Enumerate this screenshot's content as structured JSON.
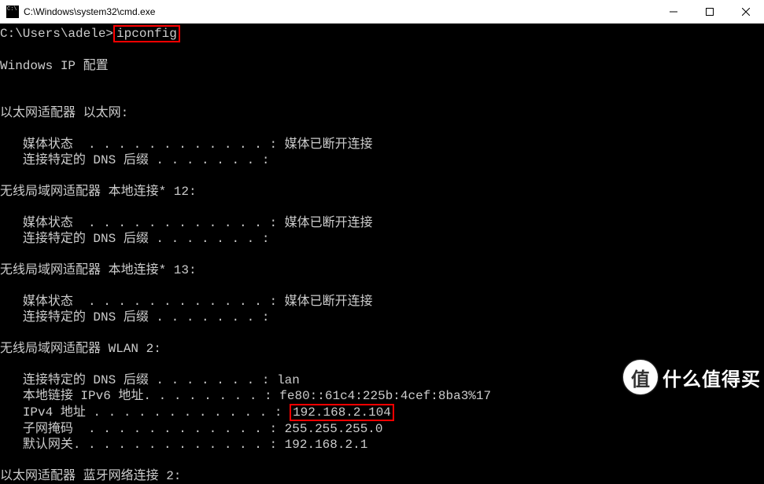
{
  "window": {
    "title": "C:\\Windows\\system32\\cmd.exe"
  },
  "prompt": {
    "path": "C:\\Users\\adele>",
    "command": "ipconfig"
  },
  "header": "Windows IP 配置",
  "adapters": {
    "ethernet": {
      "title": "以太网适配器 以太网:",
      "media_label": "媒体状态  . . . . . . . . . . . . : ",
      "media_value": "媒体已断开连接",
      "dns_label": "连接特定的 DNS 后缀 . . . . . . . :"
    },
    "wlan12": {
      "title": "无线局域网适配器 本地连接* 12:",
      "media_label": "媒体状态  . . . . . . . . . . . . : ",
      "media_value": "媒体已断开连接",
      "dns_label": "连接特定的 DNS 后缀 . . . . . . . :"
    },
    "wlan13": {
      "title": "无线局域网适配器 本地连接* 13:",
      "media_label": "媒体状态  . . . . . . . . . . . . : ",
      "media_value": "媒体已断开连接",
      "dns_label": "连接特定的 DNS 后缀 . . . . . . . :"
    },
    "wlan2": {
      "title": "无线局域网适配器 WLAN 2:",
      "dns_label": "连接特定的 DNS 后缀 . . . . . . . : ",
      "dns_value": "lan",
      "ipv6_label": "本地链接 IPv6 地址. . . . . . . . : ",
      "ipv6_value": "fe80::61c4:225b:4cef:8ba3%17",
      "ipv4_label": "IPv4 地址 . . . . . . . . . . . . : ",
      "ipv4_value": "192.168.2.104",
      "mask_label": "子网掩码  . . . . . . . . . . . . : ",
      "mask_value": "255.255.255.0",
      "gw_label": "默认网关. . . . . . . . . . . . . : ",
      "gw_value": "192.168.2.1"
    },
    "bluetooth": {
      "title": "以太网适配器 蓝牙网络连接 2:"
    }
  },
  "watermark": {
    "badge": "值",
    "text": "什么值得买"
  }
}
